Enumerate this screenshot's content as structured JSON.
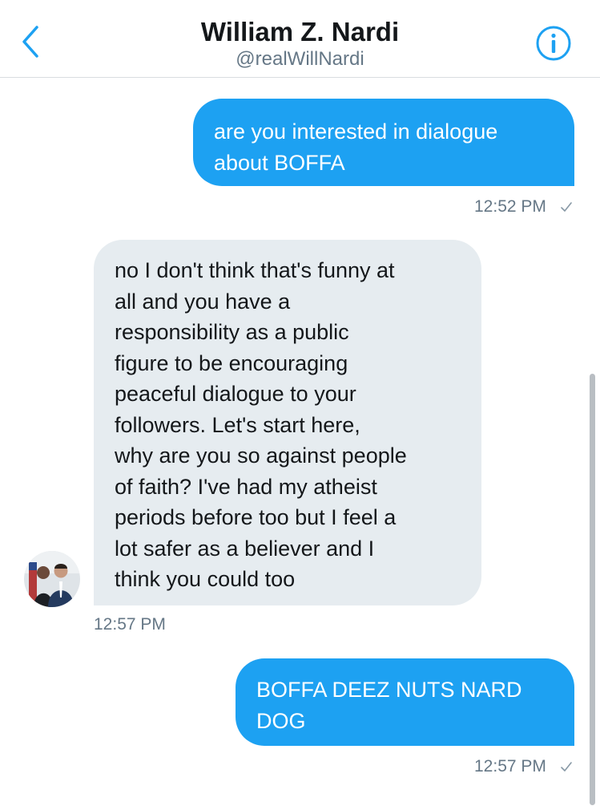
{
  "header": {
    "name": "William Z. Nardi",
    "handle": "@realWillNardi"
  },
  "messages": [
    {
      "direction": "outgoing",
      "text": "are you interested in dialogue\nabout BOFFA",
      "time": "12:52 PM"
    },
    {
      "direction": "incoming",
      "text": "no I don't think that's funny at\nall and you have a\nresponsibility as a public\nfigure to be encouraging\npeaceful dialogue to your\nfollowers. Let's start here,\nwhy are you so against people\nof faith? I've had my atheist\nperiods before too but I feel a\nlot safer as a believer and I\nthink you could too",
      "time": "12:57 PM"
    },
    {
      "direction": "outgoing",
      "text": "BOFFA DEEZ NUTS NARD\nDOG",
      "time": "12:57 PM"
    }
  ],
  "colors": {
    "accent": "#1da1f2",
    "incoming_bubble": "#e6ecf0",
    "muted_text": "#657786"
  },
  "icons": [
    "chevron-left-icon",
    "info-icon",
    "sent-check-icon"
  ]
}
